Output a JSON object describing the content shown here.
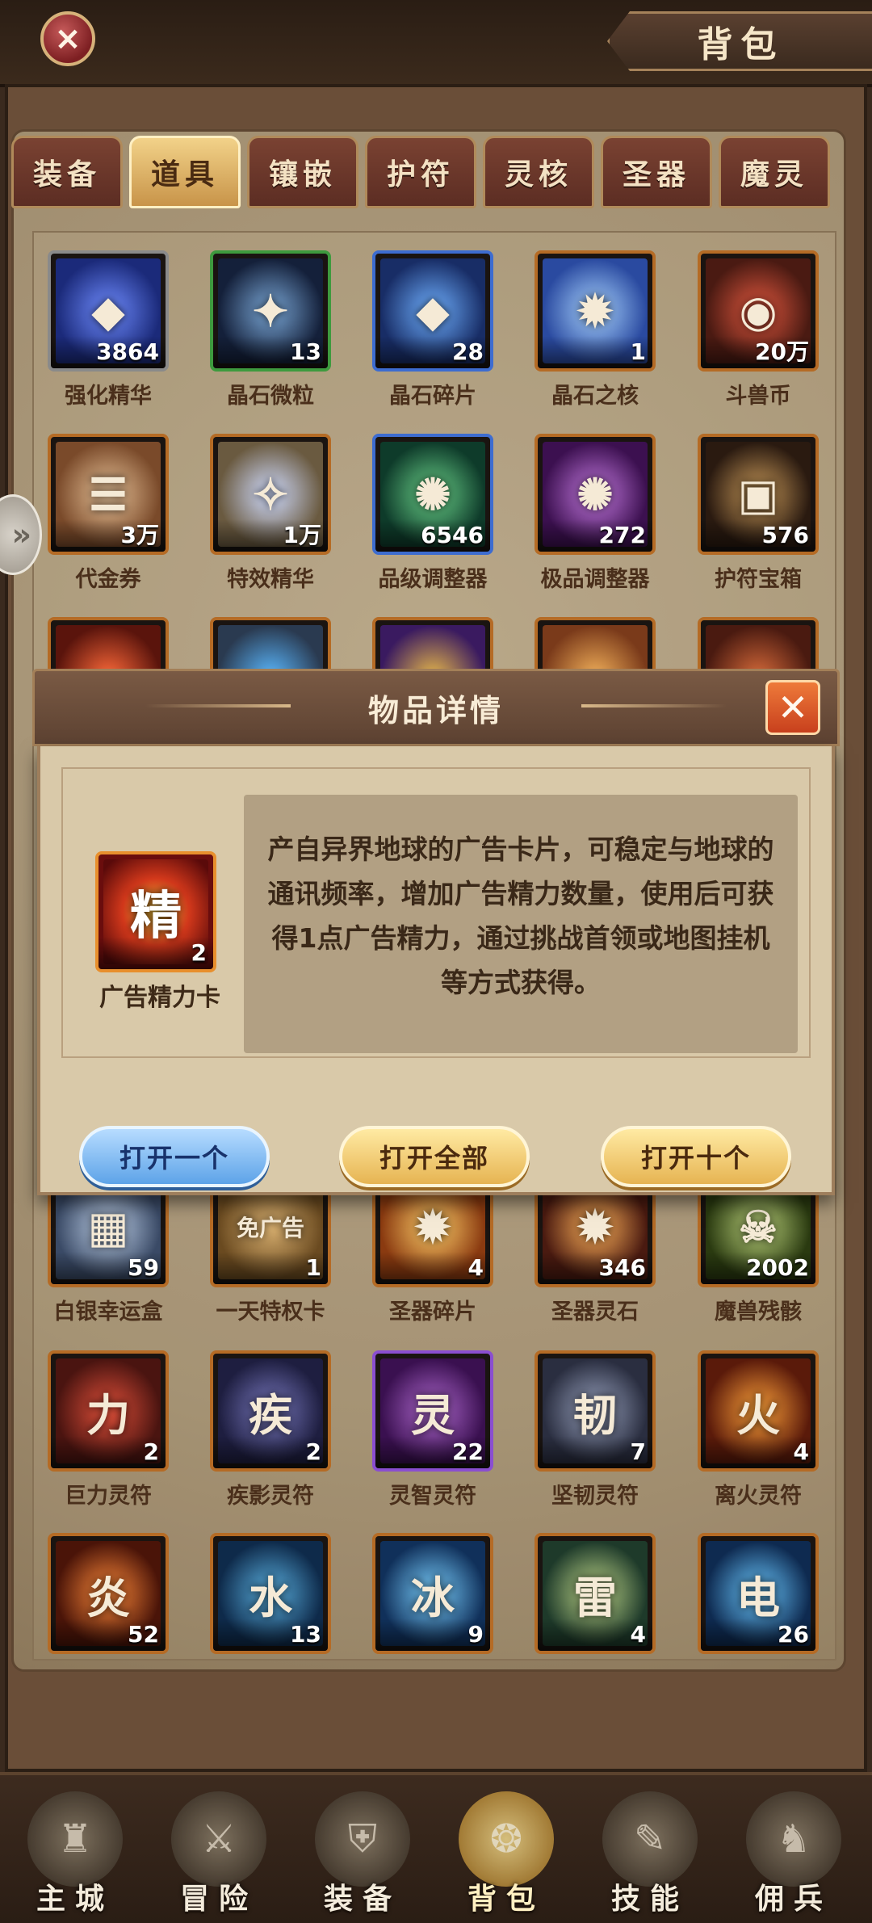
{
  "header": {
    "title": "背包",
    "close_icon": "close-icon"
  },
  "tabs": [
    {
      "label": "装备",
      "active": false
    },
    {
      "label": "道具",
      "active": true
    },
    {
      "label": "镶嵌",
      "active": false
    },
    {
      "label": "护符",
      "active": false
    },
    {
      "label": "灵核",
      "active": false
    },
    {
      "label": "圣器",
      "active": false
    },
    {
      "label": "魔灵",
      "active": false
    }
  ],
  "side_arrow": "»",
  "items_row1": [
    {
      "name": "强化精华",
      "count": "3864",
      "glyph": "◆"
    },
    {
      "name": "晶石微粒",
      "count": "13",
      "glyph": "✦"
    },
    {
      "name": "晶石碎片",
      "count": "28",
      "glyph": "◆"
    },
    {
      "name": "晶石之核",
      "count": "1",
      "glyph": "✹"
    },
    {
      "name": "斗兽币",
      "count": "20万",
      "glyph": "◉"
    }
  ],
  "items_row2": [
    {
      "name": "代金券",
      "count": "3万",
      "glyph": "☰"
    },
    {
      "name": "特效精华",
      "count": "1万",
      "glyph": "✧"
    },
    {
      "name": "品级调整器",
      "count": "6546",
      "glyph": "✺"
    },
    {
      "name": "极品调整器",
      "count": "272",
      "glyph": "✺"
    },
    {
      "name": "护符宝箱",
      "count": "576",
      "glyph": "▣"
    }
  ],
  "items_row3": [
    {
      "name": "",
      "count": "",
      "glyph": ""
    },
    {
      "name": "",
      "count": "",
      "glyph": ""
    },
    {
      "name": "",
      "count": "",
      "glyph": ""
    },
    {
      "name": "",
      "count": "",
      "glyph": ""
    },
    {
      "name": "",
      "count": "",
      "glyph": ""
    }
  ],
  "items_row4": [
    {
      "name": "白银幸运盒",
      "count": "59",
      "glyph": "▦"
    },
    {
      "name": "一天特权卡",
      "count": "1",
      "glyph": "免广告"
    },
    {
      "name": "圣器碎片",
      "count": "4",
      "glyph": "✹"
    },
    {
      "name": "圣器灵石",
      "count": "346",
      "glyph": "✹"
    },
    {
      "name": "魔兽残骸",
      "count": "2002",
      "glyph": "☠"
    }
  ],
  "items_row5": [
    {
      "name": "巨力灵符",
      "count": "2",
      "glyph": "力"
    },
    {
      "name": "疾影灵符",
      "count": "2",
      "glyph": "疾"
    },
    {
      "name": "灵智灵符",
      "count": "22",
      "glyph": "灵"
    },
    {
      "name": "坚韧灵符",
      "count": "7",
      "glyph": "韧"
    },
    {
      "name": "离火灵符",
      "count": "4",
      "glyph": "火"
    }
  ],
  "items_row6": [
    {
      "name": "",
      "count": "52",
      "glyph": "炎"
    },
    {
      "name": "",
      "count": "13",
      "glyph": "水"
    },
    {
      "name": "",
      "count": "9",
      "glyph": "冰"
    },
    {
      "name": "",
      "count": "4",
      "glyph": "雷"
    },
    {
      "name": "",
      "count": "26",
      "glyph": "电"
    }
  ],
  "dialog": {
    "title": "物品详情",
    "item_name": "广告精力卡",
    "item_count": "2",
    "item_glyph": "精",
    "description": "产自异界地球的广告卡片，可稳定与地球的通讯频率，增加广告精力数量，使用后可获得1点广告精力，通过挑战首领或地图挂机等方式获得。",
    "buttons": {
      "open_one": "打开一个",
      "open_all": "打开全部",
      "open_ten": "打开十个"
    }
  },
  "bottom_nav": [
    {
      "label": "主城",
      "icon": "castle-icon",
      "glyph": "♜"
    },
    {
      "label": "冒险",
      "icon": "crossed-swords-icon",
      "glyph": "⚔"
    },
    {
      "label": "装备",
      "icon": "helmet-icon",
      "glyph": "⛨"
    },
    {
      "label": "背包",
      "icon": "bag-icon",
      "glyph": "❂"
    },
    {
      "label": "技能",
      "icon": "skill-book-icon",
      "glyph": "✎"
    },
    {
      "label": "佣兵",
      "icon": "knight-icon",
      "glyph": "♞"
    }
  ],
  "colors": {
    "accent_gold": "#e6b452",
    "accent_blue": "#5da3e8",
    "panel_brown": "#6a4e38"
  }
}
